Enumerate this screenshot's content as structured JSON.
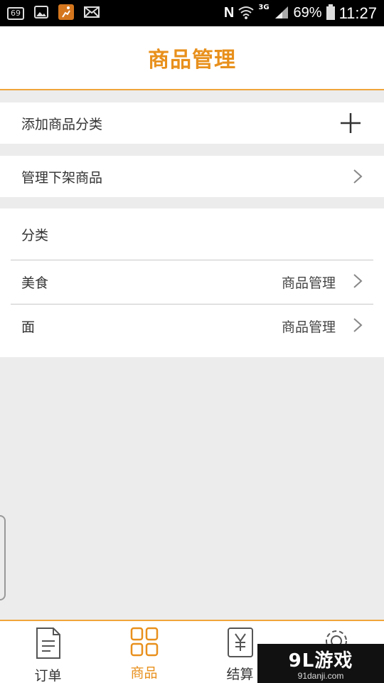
{
  "status_bar": {
    "notification_badge": "69",
    "network_type": "3G",
    "nfc": "N",
    "battery": "69%",
    "time": "11:27"
  },
  "header": {
    "title": "商品管理"
  },
  "add_category": {
    "label": "添加商品分类"
  },
  "manage_delisted": {
    "label": "管理下架商品"
  },
  "categories": {
    "header": "分类",
    "items": [
      {
        "name": "美食",
        "action": "商品管理"
      },
      {
        "name": "面",
        "action": "商品管理"
      }
    ]
  },
  "bottom_nav": {
    "items": [
      {
        "label": "订单",
        "icon": "order-doc-icon"
      },
      {
        "label": "商品",
        "icon": "grid-icon"
      },
      {
        "label": "结算",
        "icon": "yen-doc-icon"
      },
      {
        "label": "",
        "icon": "gear-icon"
      }
    ],
    "active_index": 1
  },
  "watermark": {
    "main": "9L游戏",
    "sub": "91danji.com"
  },
  "colors": {
    "accent": "#e8901c",
    "background": "#ececec"
  }
}
